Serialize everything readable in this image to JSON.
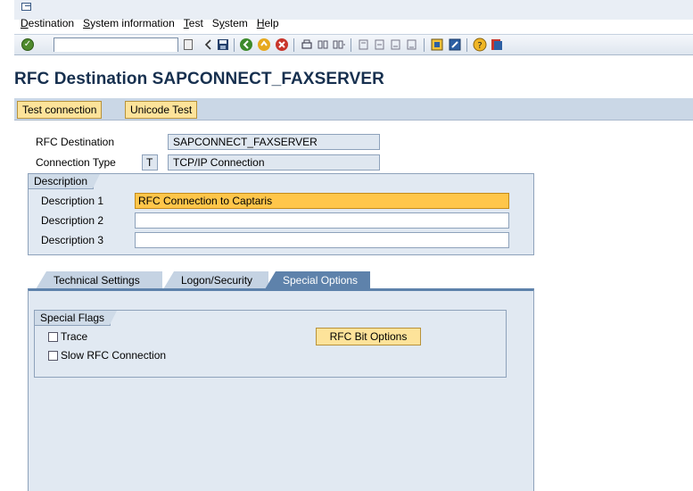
{
  "menu": {
    "items": [
      {
        "pre": "",
        "u": "D",
        "rest": "estination"
      },
      {
        "pre": "",
        "u": "S",
        "rest": "ystem information"
      },
      {
        "pre": "",
        "u": "T",
        "rest": "est"
      },
      {
        "pre": "S",
        "u": "y",
        "rest": "stem"
      },
      {
        "pre": "",
        "u": "H",
        "rest": "elp"
      }
    ]
  },
  "toolbar": {
    "command_value": ""
  },
  "page": {
    "title": "RFC Destination SAPCONNECT_FAXSERVER"
  },
  "actions": {
    "test_connection": "Test connection",
    "unicode_test": "Unicode Test"
  },
  "header": {
    "rfc_destination_label": "RFC Destination",
    "rfc_destination_value": "SAPCONNECT_FAXSERVER",
    "connection_type_label": "Connection Type",
    "connection_type_code": "T",
    "connection_type_value": "TCP/IP Connection"
  },
  "description": {
    "title": "Description",
    "d1_label": "Description 1",
    "d1_value": "RFC Connection to Captaris",
    "d2_label": "Description 2",
    "d2_value": "",
    "d3_label": "Description 3",
    "d3_value": ""
  },
  "tabs": [
    {
      "label": "Technical Settings",
      "active": false
    },
    {
      "label": "Logon/Security",
      "active": false
    },
    {
      "label": "Special Options",
      "active": true
    }
  ],
  "special": {
    "title": "Special Flags",
    "trace_label": "Trace",
    "slow_rfc_label": "Slow RFC Connection",
    "rfc_bit_options": "RFC Bit Options"
  },
  "colors": {
    "title": "#17304f",
    "button": "#fde39a",
    "focus": "#ffc64a",
    "active_tab": "#5e82ab"
  }
}
